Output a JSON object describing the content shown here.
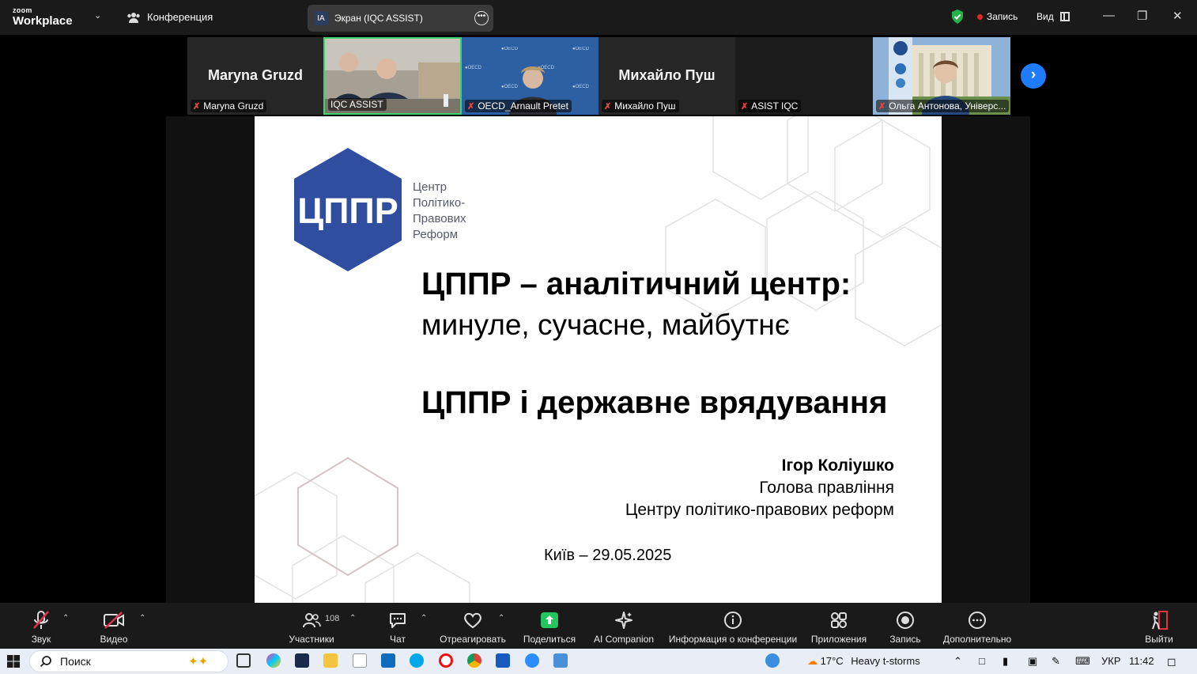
{
  "app": {
    "brand_top": "zoom",
    "brand_bottom": "Workplace",
    "meeting_menu": "Конференция",
    "share_pill": {
      "avatar": "IA",
      "label": "Экран (IQC ASSIST)"
    },
    "recording": "Запись",
    "view": "Вид"
  },
  "participants": [
    {
      "big": "Maryna Gruzd",
      "name": "Maryna Gruzd"
    },
    {
      "big": "",
      "name": "IQC ASSIST"
    },
    {
      "big": "",
      "name": "OECD_Arnault Pretet"
    },
    {
      "big": "Михайло Пуш",
      "name": "Михайло Пуш"
    },
    {
      "big": "",
      "name": "ASIST IQC"
    },
    {
      "big": "",
      "name": "Ольга Антонова, Універс..."
    }
  ],
  "oecd_label": "OECD",
  "slide": {
    "logo_mark": "ЦППР",
    "logo_text": [
      "Центр",
      "Політико-",
      "Правових",
      "Реформ"
    ],
    "title_bold": "ЦППР – аналітичний центр:",
    "title_regular": "минуле, сучасне, майбутнє",
    "subtitle": "ЦППР і державне врядування",
    "author_name": "Ігор Коліушко",
    "author_role": "Голова правління",
    "author_org": "Центру політико-правових реформ",
    "place_date": "Київ – 29.05.2025"
  },
  "toolbar": {
    "audio": "Звук",
    "video": "Видео",
    "participants": "Участники",
    "participants_count": "108",
    "chat": "Чат",
    "react": "Отреагировать",
    "share": "Поделиться",
    "ai": "AI Companion",
    "info": "Информация о конференции",
    "apps": "Приложения",
    "record": "Запись",
    "more": "Дополнительно",
    "leave": "Выйти"
  },
  "taskbar": {
    "search_placeholder": "Поиск",
    "weather": "17°C",
    "weather_desc": "Heavy t-storms",
    "language": "УКР",
    "time": "11:42"
  },
  "colors": {
    "logo_blue": "#2f4ea0",
    "active_speaker": "#3fd36f",
    "share_green": "#22c55e",
    "record_red": "#e02828"
  }
}
